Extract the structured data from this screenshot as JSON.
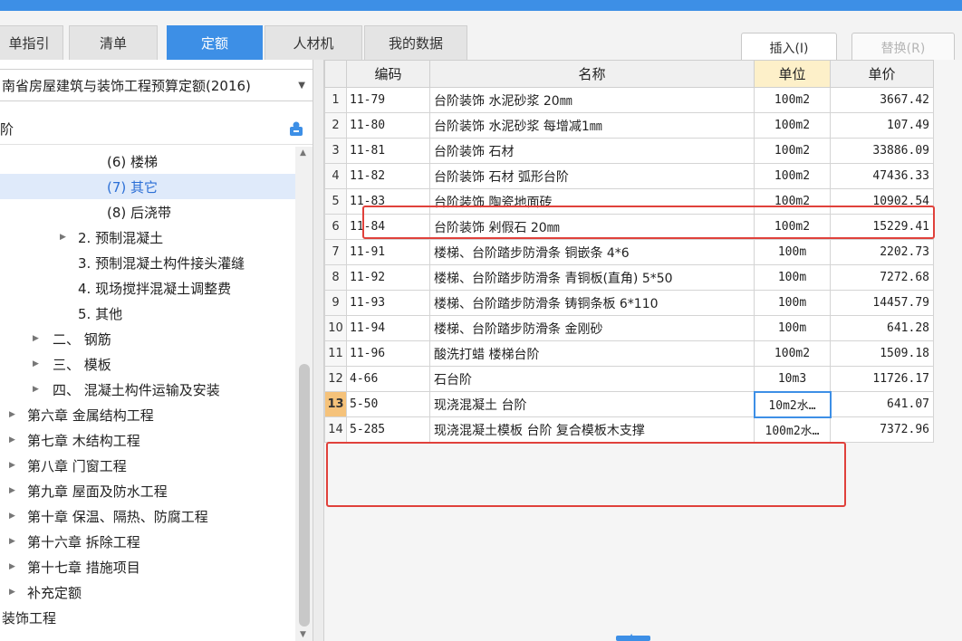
{
  "tabs": [
    {
      "label": "单指引"
    },
    {
      "label": "清单"
    },
    {
      "label": "定额"
    },
    {
      "label": "人材机"
    },
    {
      "label": "我的数据"
    }
  ],
  "buttons": {
    "insert": "插入(I)",
    "replace": "替换(R)"
  },
  "left": {
    "quota_select": "南省房屋建筑与装饰工程预算定额(2016)",
    "search_text": "阶",
    "tree": [
      {
        "label": "(6) 楼梯"
      },
      {
        "label": "(7) 其它"
      },
      {
        "label": "(8) 后浇带"
      },
      {
        "label": "2. 预制混凝土"
      },
      {
        "label": "3. 预制混凝土构件接头灌缝"
      },
      {
        "label": "4. 现场搅拌混凝土调整费"
      },
      {
        "label": "5. 其他"
      },
      {
        "label": "二、 钢筋"
      },
      {
        "label": "三、 模板"
      },
      {
        "label": "四、 混凝土构件运输及安装"
      },
      {
        "label": "第六章 金属结构工程"
      },
      {
        "label": "第七章 木结构工程"
      },
      {
        "label": "第八章 门窗工程"
      },
      {
        "label": "第九章 屋面及防水工程"
      },
      {
        "label": "第十章 保温、隔热、防腐工程"
      },
      {
        "label": "第十六章 拆除工程"
      },
      {
        "label": "第十七章 措施项目"
      },
      {
        "label": "补充定额"
      },
      {
        "label": "装饰工程"
      }
    ]
  },
  "table": {
    "headers": {
      "code": "编码",
      "name": "名称",
      "unit": "单位",
      "price": "单价"
    },
    "rows": [
      {
        "num": "1",
        "code": "11-79",
        "name": "台阶装饰 水泥砂浆 20㎜",
        "unit": "100m2",
        "price": "3667.42"
      },
      {
        "num": "2",
        "code": "11-80",
        "name": "台阶装饰 水泥砂浆 每增减1㎜",
        "unit": "100m2",
        "price": "107.49"
      },
      {
        "num": "3",
        "code": "11-81",
        "name": "台阶装饰 石材",
        "unit": "100m2",
        "price": "33886.09"
      },
      {
        "num": "4",
        "code": "11-82",
        "name": "台阶装饰 石材 弧形台阶",
        "unit": "100m2",
        "price": "47436.33"
      },
      {
        "num": "5",
        "code": "11-83",
        "name": "台阶装饰 陶瓷地面砖",
        "unit": "100m2",
        "price": "10902.54"
      },
      {
        "num": "6",
        "code": "11-84",
        "name": "台阶装饰 剁假石 20㎜",
        "unit": "100m2",
        "price": "15229.41"
      },
      {
        "num": "7",
        "code": "11-91",
        "name": "楼梯、台阶踏步防滑条 铜嵌条 4*6",
        "unit": "100m",
        "price": "2202.73"
      },
      {
        "num": "8",
        "code": "11-92",
        "name": "楼梯、台阶踏步防滑条 青铜板(直角) 5*50",
        "unit": "100m",
        "price": "7272.68"
      },
      {
        "num": "9",
        "code": "11-93",
        "name": "楼梯、台阶踏步防滑条 铸铜条板 6*110",
        "unit": "100m",
        "price": "14457.79"
      },
      {
        "num": "10",
        "code": "11-94",
        "name": "楼梯、台阶踏步防滑条 金刚砂",
        "unit": "100m",
        "price": "641.28"
      },
      {
        "num": "11",
        "code": "11-96",
        "name": "酸洗打蜡 楼梯台阶",
        "unit": "100m2",
        "price": "1509.18"
      },
      {
        "num": "12",
        "code": "4-66",
        "name": "石台阶",
        "unit": "10m3",
        "price": "11726.17"
      },
      {
        "num": "13",
        "code": "5-50",
        "name": "现浇混凝土 台阶",
        "unit": "10m2水…",
        "price": "641.07"
      },
      {
        "num": "14",
        "code": "5-285",
        "name": "现浇混凝土模板 台阶 复合模板木支撑",
        "unit": "100m2水…",
        "price": "7372.96"
      }
    ]
  }
}
